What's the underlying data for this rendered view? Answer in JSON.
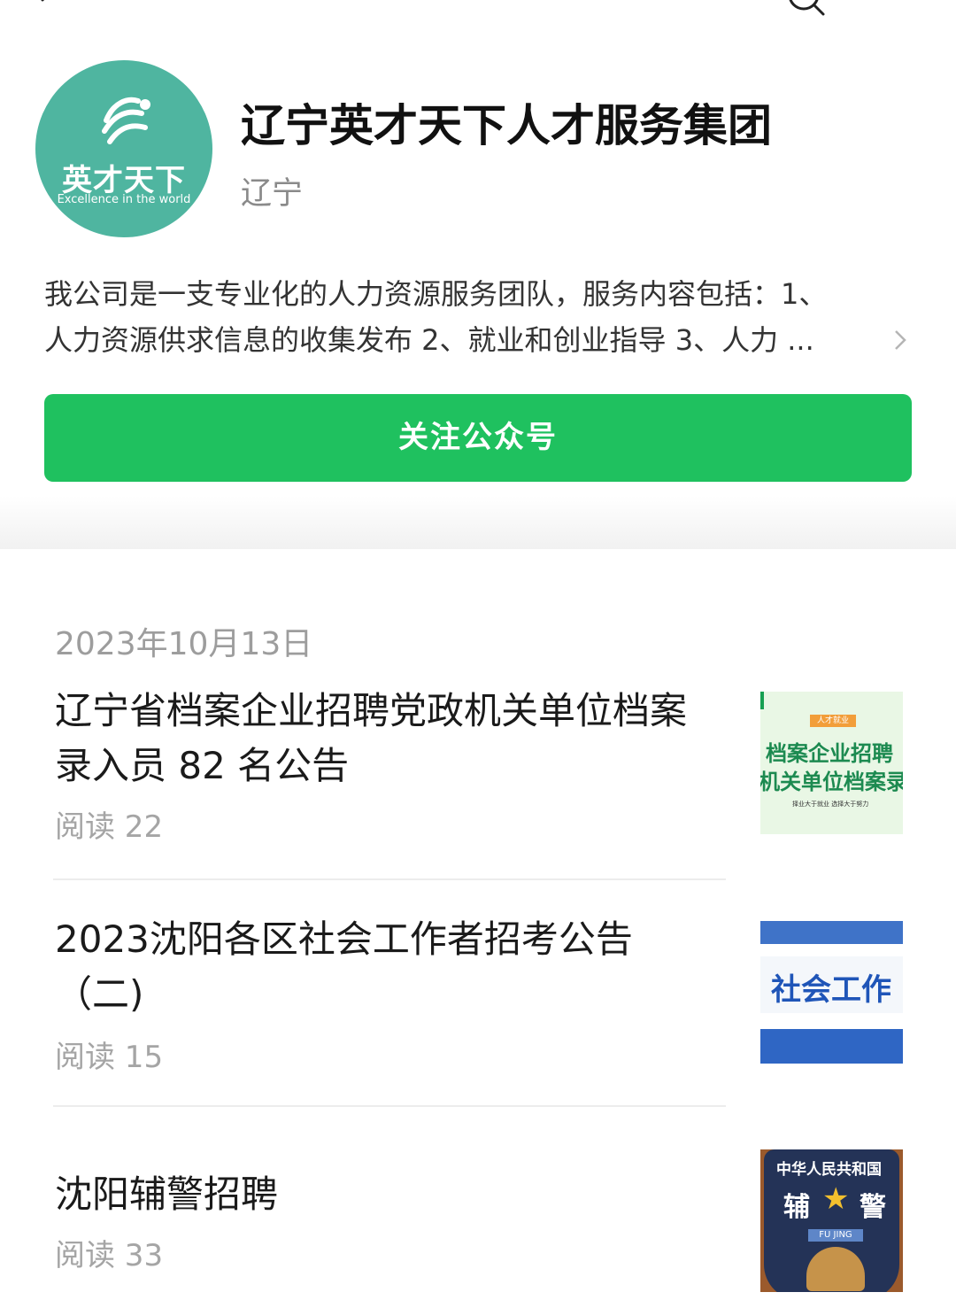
{
  "account": {
    "name": "辽宁英才天下人才服务集团",
    "region": "辽宁",
    "logo_cn": "英才天下",
    "logo_en": "Excellence in  the  world",
    "description_line1": "我公司是一支专业化的人力资源服务团队，服务内容包括：1、",
    "description_line2": "人力资源供求信息的收集发布 2、就业和创业指导 3、人力 ...",
    "follow_label": "关注公众号"
  },
  "feed": {
    "date": "2023年10月13日",
    "articles": [
      {
        "title": "辽宁省档案企业招聘党政机关单位档案录入员 82 名公告",
        "reads": "阅读 22",
        "thumb_tag": "人才就业",
        "thumb_line1": "档案企业招聘",
        "thumb_line2": "机关单位档案录",
        "thumb_line3": "择业大于就业 选择大于努力"
      },
      {
        "title": "2023沈阳各区社会工作者招考公告（二)",
        "reads": "阅读 15",
        "thumb_text": "社会工作"
      },
      {
        "title": "沈阳辅警招聘",
        "reads": "阅读 33",
        "thumb_arc": "中华人民共和国",
        "thumb_left": "辅",
        "thumb_right": "警",
        "thumb_ribbon": "FU JING"
      }
    ]
  },
  "colors": {
    "follow_button": "#1fc15f",
    "avatar_bg": "#4fb5a0"
  },
  "icons": [
    "back-arrow-icon",
    "search-icon",
    "chevron-right-icon",
    "logo-mark-icon"
  ]
}
